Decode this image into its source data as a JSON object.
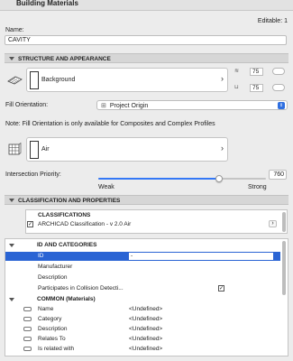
{
  "window": {
    "title": "Building Materials",
    "editable_label": "Editable: 1"
  },
  "name_field": {
    "label": "Name:",
    "value": "CAVITY"
  },
  "structure": {
    "section_title": "STRUCTURE AND APPEARANCE",
    "surface": "Background",
    "pen_value_1": "75",
    "pen_value_2": "75",
    "fill_orientation_label": "Fill Orientation:",
    "fill_orientation_value": "Project Origin",
    "note": "Note: Fill Orientation is only available for Composites and Complex Profiles",
    "fill": "Air",
    "intersection_label": "Intersection Priority:",
    "intersection_value": "760",
    "intersection_fraction": 0.72,
    "slider_min_label": "Weak",
    "slider_max_label": "Strong"
  },
  "classification": {
    "section_title": "CLASSIFICATION AND PROPERTIES",
    "header": "CLASSIFICATIONS",
    "item": "ARCHICAD Classification - v 2.0 Air",
    "item_checked": true
  },
  "properties": {
    "group1_title": "ID AND CATEGORIES",
    "rows1": [
      {
        "name": "ID",
        "value": "-",
        "selected": true
      },
      {
        "name": "Manufacturer",
        "value": ""
      },
      {
        "name": "Description",
        "value": ""
      },
      {
        "name": "Participates in Collision Detecti...",
        "value": "",
        "checkbox": true
      }
    ],
    "group2_title": "COMMON (Materials)",
    "rows2": [
      {
        "name": "Name",
        "value": "<Undefined>"
      },
      {
        "name": "Category",
        "value": "<Undefined>"
      },
      {
        "name": "Description",
        "value": "<Undefined>"
      },
      {
        "name": "Relates To",
        "value": "<Undefined>"
      },
      {
        "name": "Is related with",
        "value": "<Undefined>"
      }
    ]
  },
  "colors": {
    "accent": "#3478f6",
    "selection": "#2a64d4"
  }
}
